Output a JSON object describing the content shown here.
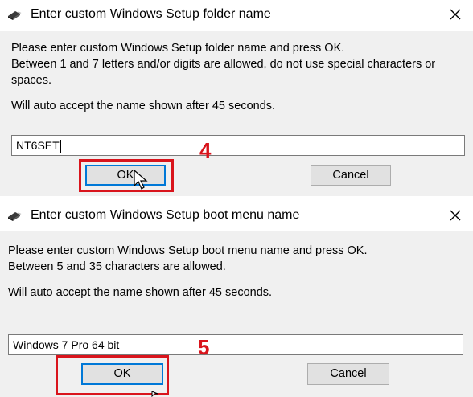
{
  "dialog1": {
    "title": "Enter custom Windows Setup folder name",
    "icon": "usb-drive-icon",
    "message_line1": "Please enter custom Windows Setup folder name and press OK.",
    "message_line2": "Between 1 and 7 letters and/or digits are allowed, do not use special characters or",
    "message_line3": "spaces.",
    "timeout_text": "Will auto accept the name shown after 45 seconds.",
    "input_value": "NT6SET",
    "ok_label": "OK",
    "cancel_label": "Cancel",
    "step_number": "4"
  },
  "dialog2": {
    "title": "Enter custom Windows Setup boot menu name",
    "icon": "usb-drive-icon",
    "message_line1": "Please enter custom Windows Setup boot menu name and press OK.",
    "message_line2": "Between 5 and 35 characters are allowed.",
    "timeout_text": "Will auto accept the name shown after 45 seconds.",
    "input_value": "Windows 7 Pro 64 bit",
    "ok_label": "OK",
    "cancel_label": "Cancel",
    "step_number": "5"
  },
  "colors": {
    "highlight": "#d9141c",
    "default_button_border": "#0078d7",
    "dialog_background": "#f0f0f0"
  }
}
